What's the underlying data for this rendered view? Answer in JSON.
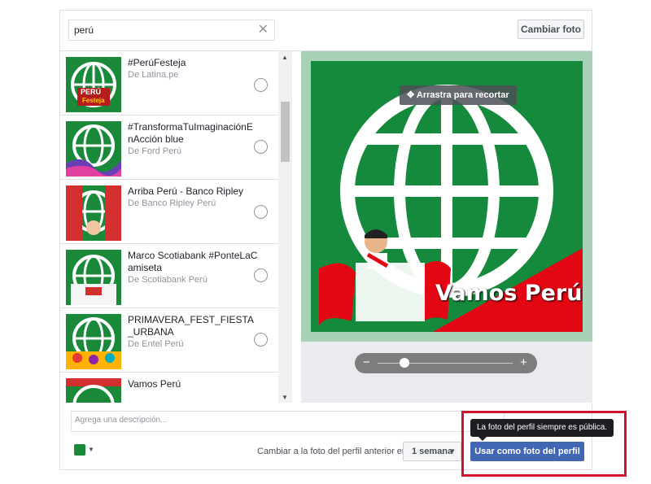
{
  "search": {
    "value": "perú",
    "clear_icon": "close-icon"
  },
  "header": {
    "change_photo_label": "Cambiar foto"
  },
  "results": [
    {
      "title": "#PerúFesteja",
      "source": "De Latina.pe",
      "thumb_text": "PERÚ",
      "thumb_sub": "Festeja"
    },
    {
      "title": "#TransformaTuImaginaciónEnAcción blue",
      "source": "De Ford Perú"
    },
    {
      "title": "Arriba Perú - Banco Ripley",
      "source": "De Banco Ripley Perú"
    },
    {
      "title": "Marco Scotiabank #PonteLaCamiseta",
      "source": "De Scotiabank Perú"
    },
    {
      "title": "PRIMAVERA_FEST_FIESTA_URBANA",
      "source": "De Entel Perú"
    },
    {
      "title": "Vamos Perú",
      "source": ""
    }
  ],
  "preview": {
    "drag_hint": "Arrastra para recortar",
    "overlay_text": "Vamos Perú !",
    "zoom_level": 0.2,
    "colors": {
      "green": "#168a3c",
      "frame": "#a8d2b6",
      "red": "#e30613"
    }
  },
  "description": {
    "placeholder": "Agrega una descripción..."
  },
  "footer": {
    "revert_label": "Cambiar a la foto del perfil anterior en",
    "duration": "1 semana",
    "primary_label": "Usar como foto del perfil",
    "tooltip": "La foto del perfil siempre es pública."
  }
}
